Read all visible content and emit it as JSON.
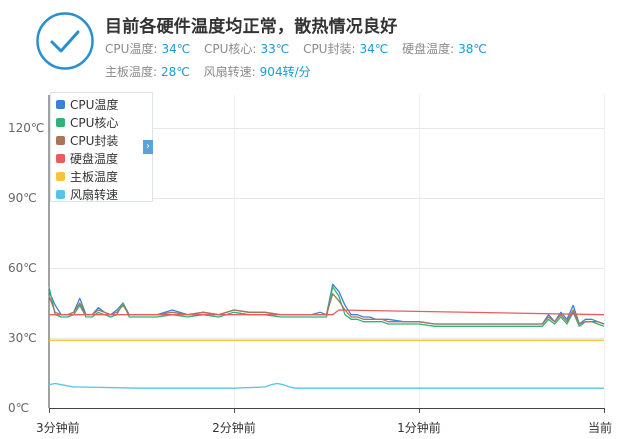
{
  "summary": {
    "headline": "目前各硬件温度均正常，散热情况良好",
    "metrics": [
      {
        "label": "CPU温度:",
        "value": "34℃"
      },
      {
        "label": "CPU核心:",
        "value": "33℃"
      },
      {
        "label": "CPU封装:",
        "value": "34℃"
      },
      {
        "label": "硬盘温度:",
        "value": "38℃"
      },
      {
        "label": "主板温度:",
        "value": "28℃"
      },
      {
        "label": "风扇转速:",
        "value": "904转/分"
      }
    ],
    "status_icon": "checkmark-circle-icon",
    "accent_color": "#2a8fd0"
  },
  "legend_toggle_icon": "chevron-right-icon",
  "chart_data": {
    "type": "line",
    "y_ticks": [
      "120℃",
      "90℃",
      "60℃",
      "30℃",
      "0℃"
    ],
    "ylim": [
      0,
      120
    ],
    "x_ticks": [
      "3分钟前",
      "2分钟前",
      "1分钟前",
      "当前"
    ],
    "xlim": [
      0,
      180
    ],
    "grid": true,
    "legend_position": "top-left",
    "series": [
      {
        "name": "CPU温度",
        "color": "#3b82d6",
        "x": [
          0,
          2,
          4,
          6,
          8,
          10,
          12,
          14,
          16,
          18,
          20,
          22,
          24,
          26,
          28,
          30,
          35,
          40,
          45,
          50,
          55,
          60,
          65,
          70,
          75,
          80,
          85,
          88,
          90,
          92,
          94,
          96,
          98,
          100,
          102,
          104,
          106,
          108,
          110,
          115,
          120,
          125,
          130,
          135,
          140,
          145,
          150,
          155,
          160,
          162,
          164,
          166,
          168,
          170,
          172,
          174,
          176,
          178,
          180
        ],
        "y": [
          50,
          44,
          40,
          40,
          41,
          47,
          40,
          40,
          43,
          41,
          40,
          42,
          45,
          40,
          40,
          40,
          40,
          42,
          40,
          41,
          40,
          42,
          41,
          41,
          40,
          40,
          40,
          41,
          40,
          53,
          50,
          44,
          40,
          40,
          39,
          39,
          38,
          38,
          38,
          37,
          37,
          36,
          36,
          36,
          36,
          36,
          36,
          36,
          36,
          40,
          37,
          41,
          38,
          44,
          36,
          38,
          38,
          37,
          36
        ]
      },
      {
        "name": "CPU核心",
        "color": "#2fb377",
        "x": [
          0,
          2,
          4,
          6,
          8,
          10,
          12,
          14,
          16,
          18,
          20,
          22,
          24,
          26,
          28,
          30,
          35,
          40,
          45,
          50,
          55,
          60,
          65,
          70,
          75,
          80,
          85,
          88,
          90,
          92,
          94,
          96,
          98,
          100,
          102,
          104,
          106,
          108,
          110,
          115,
          120,
          125,
          130,
          135,
          140,
          145,
          150,
          155,
          160,
          162,
          164,
          166,
          168,
          170,
          172,
          174,
          176,
          178,
          180
        ],
        "y": [
          52,
          40,
          39,
          39,
          40,
          44,
          39,
          39,
          41,
          40,
          39,
          40,
          45,
          39,
          39,
          39,
          39,
          40,
          39,
          40,
          39,
          41,
          40,
          40,
          39,
          39,
          39,
          39,
          39,
          52,
          48,
          40,
          38,
          38,
          37,
          37,
          37,
          37,
          36,
          36,
          36,
          35,
          35,
          35,
          35,
          35,
          35,
          35,
          35,
          38,
          36,
          39,
          36,
          41,
          35,
          37,
          37,
          36,
          35
        ]
      },
      {
        "name": "CPU封装",
        "color": "#a8745a",
        "x": [
          0,
          2,
          4,
          6,
          8,
          10,
          12,
          14,
          16,
          18,
          20,
          22,
          24,
          26,
          28,
          30,
          35,
          40,
          45,
          50,
          55,
          60,
          65,
          70,
          75,
          80,
          85,
          88,
          90,
          92,
          94,
          96,
          98,
          100,
          102,
          104,
          106,
          108,
          110,
          115,
          120,
          125,
          130,
          135,
          140,
          145,
          150,
          155,
          160,
          162,
          164,
          166,
          168,
          170,
          172,
          174,
          176,
          178,
          180
        ],
        "y": [
          48,
          41,
          40,
          40,
          41,
          45,
          40,
          40,
          42,
          41,
          40,
          41,
          44,
          40,
          40,
          40,
          40,
          41,
          40,
          41,
          40,
          42,
          41,
          41,
          40,
          40,
          40,
          40,
          40,
          49,
          46,
          42,
          39,
          39,
          38,
          38,
          38,
          38,
          37,
          37,
          37,
          36,
          36,
          36,
          36,
          36,
          36,
          36,
          36,
          39,
          37,
          40,
          37,
          42,
          36,
          37,
          37,
          37,
          36
        ]
      },
      {
        "name": "硬盘温度",
        "color": "#e85d5d",
        "x": [
          0,
          92,
          94,
          180
        ],
        "y": [
          40,
          40,
          42,
          40
        ]
      },
      {
        "name": "主板温度",
        "color": "#f3c53c",
        "x": [
          0,
          180
        ],
        "y": [
          29,
          29
        ]
      },
      {
        "name": "风扇转速",
        "color": "#55c6e6",
        "x": [
          0,
          2,
          4,
          6,
          8,
          10,
          30,
          60,
          70,
          72,
          74,
          76,
          78,
          80,
          100,
          130,
          160,
          180
        ],
        "y": [
          10,
          10.5,
          10,
          9.5,
          9,
          9,
          8.5,
          8.5,
          9,
          10,
          10.5,
          10,
          9,
          8.5,
          8.5,
          8.5,
          8.5,
          8.5
        ]
      }
    ]
  }
}
